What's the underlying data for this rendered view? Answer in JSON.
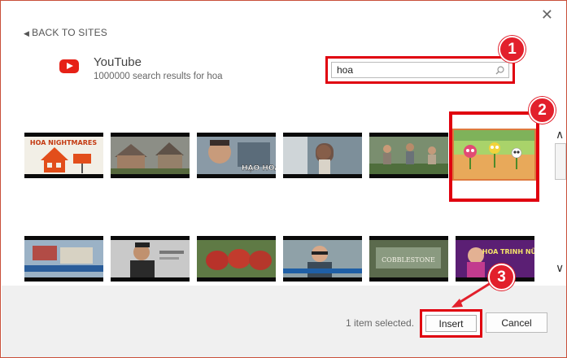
{
  "dialog": {
    "close_glyph": "✕",
    "back_label": "BACK TO SITES",
    "back_icon": "chevron-left-icon"
  },
  "site": {
    "name": "YouTube",
    "results": "1000000 search results for hoa",
    "logo_color": "#e62117"
  },
  "search": {
    "value": "hoa",
    "placeholder": ""
  },
  "annotations": {
    "step1": "1",
    "step2": "2",
    "step3": "3",
    "color": "#e2202c"
  },
  "thumbnails": {
    "row1": [
      {
        "caption": "HOA NIGHTMARES"
      },
      {
        "caption": ""
      },
      {
        "caption": "HẠO HOA"
      },
      {
        "caption": ""
      },
      {
        "caption": ""
      },
      {
        "caption": ""
      }
    ],
    "row2": [
      {
        "caption": ""
      },
      {
        "caption": ""
      },
      {
        "caption": ""
      },
      {
        "caption": ""
      },
      {
        "caption": "COBBLESTONE"
      },
      {
        "caption": "HOA TRINH NỮ"
      }
    ],
    "selected_index": 5
  },
  "footer": {
    "status": "1 item selected.",
    "insert_label": "Insert",
    "cancel_label": "Cancel"
  },
  "scroll": {
    "up_glyph": "∧",
    "down_glyph": "∨"
  }
}
